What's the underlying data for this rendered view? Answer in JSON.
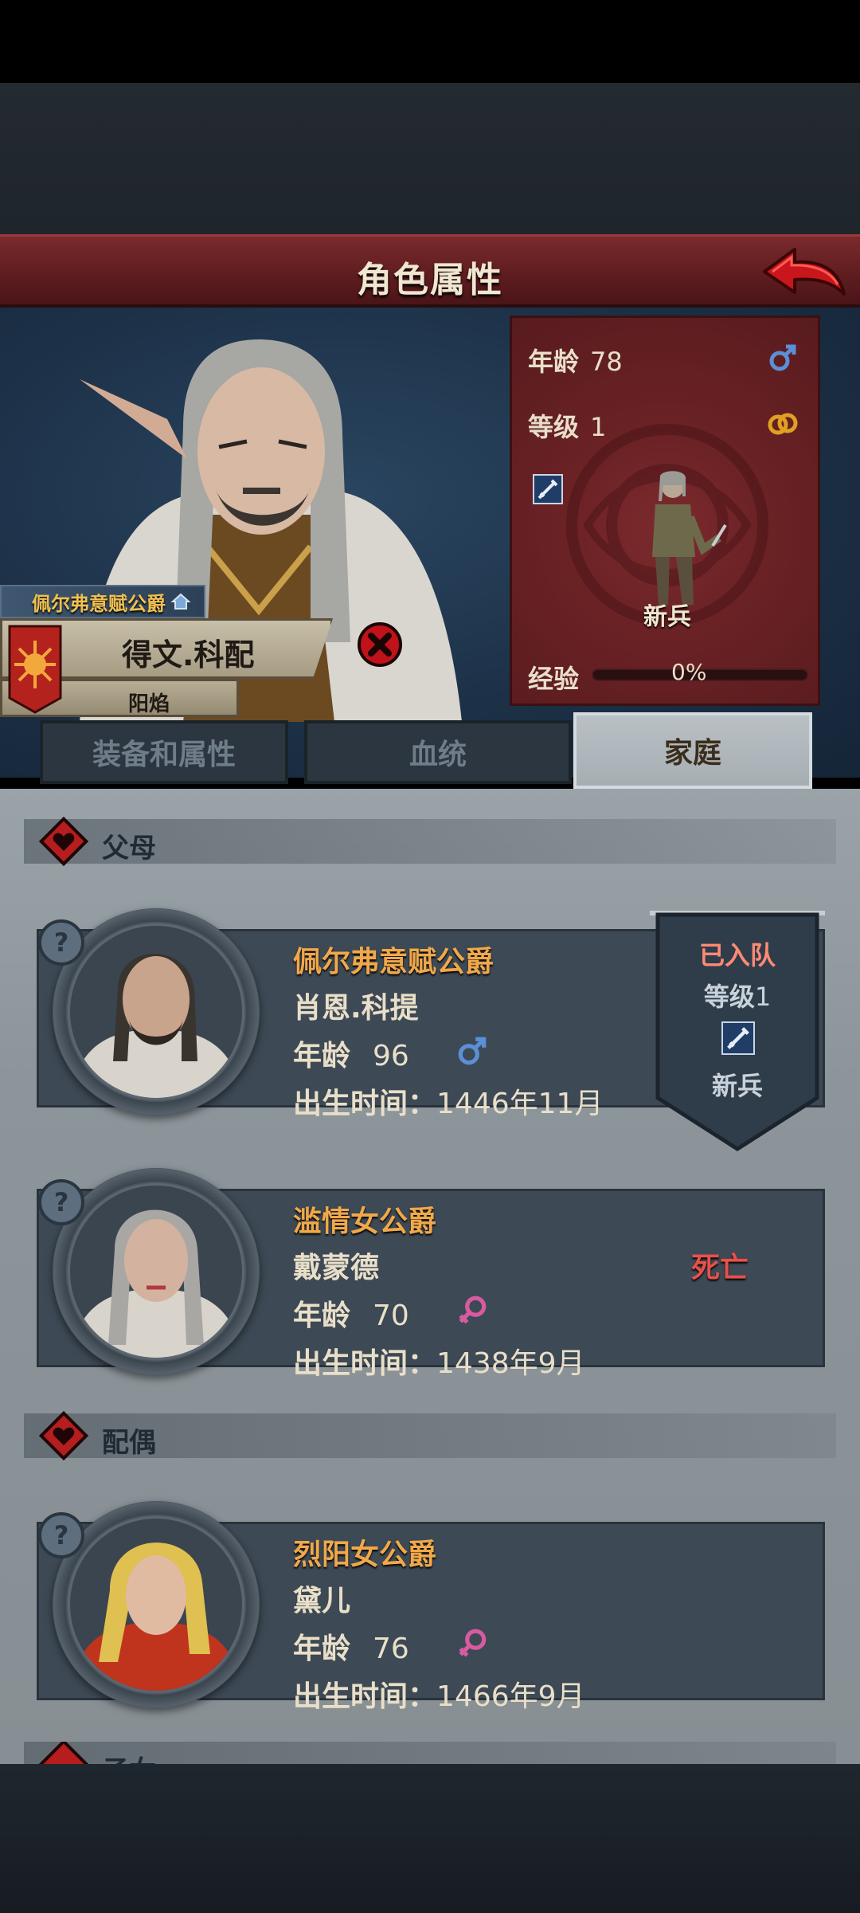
{
  "header": {
    "title": "角色属性"
  },
  "hero": {
    "rank_title": "佩尔弗意赋公爵",
    "name": "得文.科配",
    "faction": "阳焰",
    "stats": {
      "age_label": "年龄",
      "age_value": "78",
      "level_label": "等级",
      "level_value": "1",
      "class_label": "新兵",
      "exp_label": "经验",
      "exp_value": "0%",
      "exp_fraction": 0
    }
  },
  "tabs": [
    {
      "label": "装备和属性"
    },
    {
      "label": "血统"
    },
    {
      "label": "家庭"
    }
  ],
  "family": {
    "parents_label": "父母",
    "spouse_label": "配偶",
    "children_label": "子女",
    "members": [
      {
        "title": "佩尔弗意赋公爵",
        "name": "肖恩.科提",
        "age_label": "年龄",
        "age": "96",
        "sex": "male",
        "birth_label": "出生时间：",
        "birth": "1446年11月"
      },
      {
        "title": "滥情女公爵",
        "name": "戴蒙德",
        "age_label": "年龄",
        "age": "70",
        "sex": "female",
        "birth_label": "出生时间：",
        "birth": "1438年9月",
        "status": "死亡"
      },
      {
        "title": "烈阳女公爵",
        "name": "黛儿",
        "age_label": "年龄",
        "age": "76",
        "sex": "female",
        "birth_label": "出生时间：",
        "birth": "1466年9月"
      }
    ],
    "joined": {
      "status": "已入队",
      "level_label": "等级",
      "level_value": "1",
      "class_label": "新兵"
    }
  },
  "colors": {
    "title_bar": "#6b2326",
    "accent_orange": "#f0a84a",
    "dead_red": "#e8504a",
    "joined_red": "#ff8a72",
    "male_blue": "#5b8fd6",
    "female_pink": "#d65ba0"
  }
}
